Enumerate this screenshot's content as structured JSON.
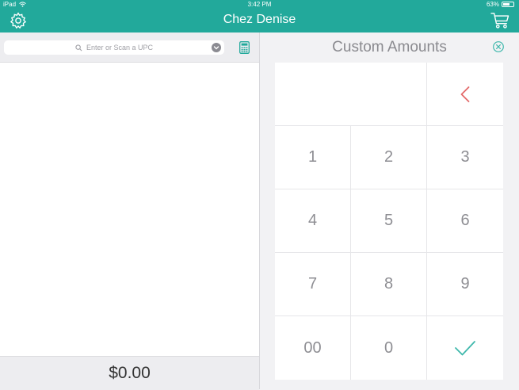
{
  "status_bar": {
    "device": "iPad",
    "time": "3:42 PM",
    "battery_percent": "63%",
    "battery_level": 0.63
  },
  "nav": {
    "title": "Chez Denise"
  },
  "search": {
    "placeholder": "Enter or Scan a UPC"
  },
  "order": {
    "total": "$0.00"
  },
  "custom": {
    "title": "Custom Amounts",
    "keys": [
      "1",
      "2",
      "3",
      "4",
      "5",
      "6",
      "7",
      "8",
      "9",
      "00",
      "0"
    ]
  },
  "colors": {
    "brand": "#22a99b",
    "backspace": "#e36a6a",
    "confirm": "#3fb8ac"
  },
  "icons": [
    "gear-icon",
    "cart-icon",
    "search-icon",
    "chevron-down-icon",
    "calculator-icon",
    "close-icon",
    "backspace-icon",
    "checkmark-icon",
    "wifi-icon",
    "battery-icon"
  ]
}
